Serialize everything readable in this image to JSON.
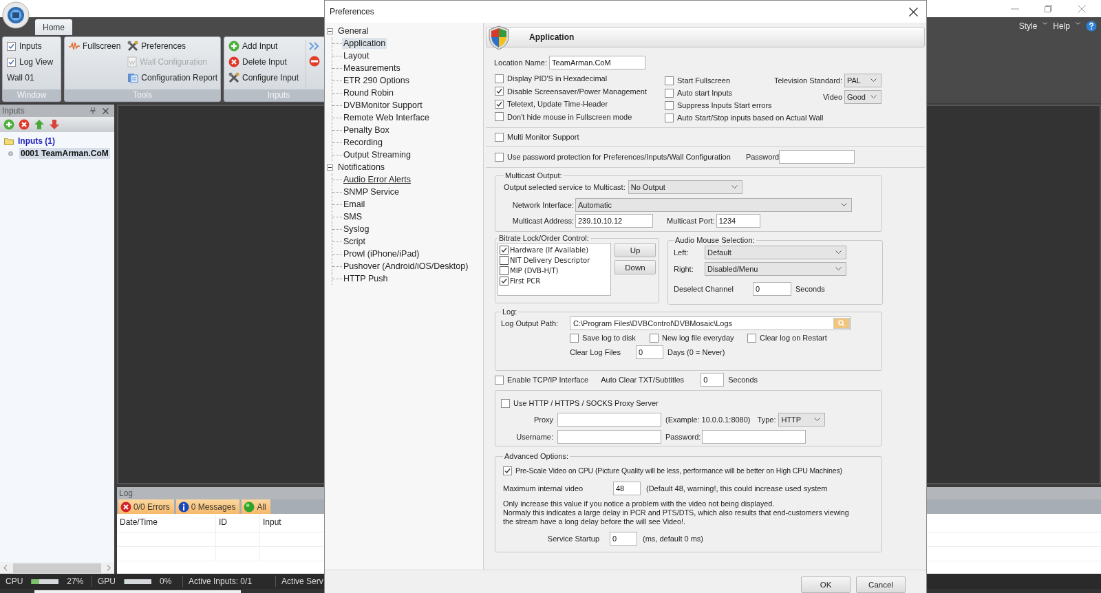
{
  "app": {
    "ribbon": {
      "tabs": [
        {
          "label": "Home",
          "selected": true
        }
      ],
      "menus": [
        {
          "label": "Style"
        },
        {
          "label": "Help"
        }
      ],
      "groups": [
        {
          "title": "Window",
          "columns": [
            [
              {
                "kind": "check",
                "label": "Inputs",
                "checked": true
              },
              {
                "kind": "check",
                "label": "Log View",
                "checked": true
              },
              {
                "kind": "text",
                "label": "Wall 01"
              }
            ]
          ]
        },
        {
          "title": "Tools",
          "columns": [
            [
              {
                "kind": "button",
                "label": "Fullscreen",
                "disabled": false
              }
            ],
            [
              {
                "kind": "button",
                "label": "Preferences",
                "disabled": false
              },
              {
                "kind": "button",
                "label": "Wall Configuration",
                "disabled": true
              },
              {
                "kind": "button",
                "label": "Configuration Report",
                "disabled": false
              }
            ]
          ]
        },
        {
          "title": "Inputs",
          "columns": [
            [
              {
                "kind": "button",
                "label": "Add Input",
                "disabled": false
              },
              {
                "kind": "button",
                "label": "Delete Input",
                "disabled": false
              },
              {
                "kind": "button",
                "label": "Configure Input",
                "disabled": false
              }
            ]
          ]
        }
      ]
    },
    "inputs_panel": {
      "title": "Inputs",
      "tree": [
        {
          "label": "Inputs (1)",
          "children": [
            {
              "label": "0001 TeamArman.CoM",
              "selected": true
            }
          ]
        }
      ]
    },
    "log_panel": {
      "title": "Log",
      "filters": [
        {
          "label": "0/0 Errors"
        },
        {
          "label": "0 Messages"
        },
        {
          "label": "All"
        }
      ],
      "columns": [
        "Date/Time",
        "ID",
        "Input"
      ]
    },
    "status_bar": {
      "cpu": {
        "label": "CPU",
        "level": 0.27,
        "reading": "27%"
      },
      "gpu": {
        "label": "GPU",
        "level": 0,
        "reading": "0%"
      },
      "texts": [
        "Active Inputs: 0/1",
        "Active Serv"
      ]
    }
  },
  "dialog": {
    "title": "Preferences",
    "tree": [
      {
        "label": "General",
        "expanded": true,
        "children": [
          {
            "label": "Application",
            "selected": true,
            "hovered": false
          },
          {
            "label": "Layout",
            "selected": false,
            "hovered": false
          },
          {
            "label": "Measurements",
            "selected": false,
            "hovered": false
          },
          {
            "label": "ETR 290 Options",
            "selected": false,
            "hovered": false
          },
          {
            "label": "Round Robin",
            "selected": false,
            "hovered": false
          },
          {
            "label": "DVBMonitor Support",
            "selected": false,
            "hovered": false
          },
          {
            "label": "Remote Web Interface",
            "selected": false,
            "hovered": false
          },
          {
            "label": "Penalty Box",
            "selected": false,
            "hovered": false
          },
          {
            "label": "Recording",
            "selected": false,
            "hovered": false
          },
          {
            "label": "Output Streaming",
            "selected": false,
            "hovered": false
          }
        ]
      },
      {
        "label": "Notifications",
        "expanded": true,
        "children": [
          {
            "label": "Audio Error Alerts",
            "selected": false,
            "hovered": true
          },
          {
            "label": "SNMP Service",
            "selected": false,
            "hovered": false
          },
          {
            "label": "Email",
            "selected": false,
            "hovered": false
          },
          {
            "label": "SMS",
            "selected": false,
            "hovered": false
          },
          {
            "label": "Syslog",
            "selected": false,
            "hovered": false
          },
          {
            "label": "Script",
            "selected": false,
            "hovered": false
          },
          {
            "label": "Prowl (iPhone/iPad)",
            "selected": false,
            "hovered": false
          },
          {
            "label": "Pushover (Android/iOS/Desktop)",
            "selected": false,
            "hovered": false
          },
          {
            "label": "HTTP Push",
            "selected": false,
            "hovered": false
          }
        ]
      }
    ],
    "settings": {
      "header": "Application",
      "location": {
        "label": "Location Name:",
        "value": "TeamArman.CoM"
      },
      "options_left": [
        {
          "label": "Display PID'S in Hexadecimal",
          "checked": false
        },
        {
          "label": "Disable Screensaver/Power Management",
          "checked": true
        },
        {
          "label": "Teletext, Update Time-Header",
          "checked": true
        },
        {
          "label": "Don't hide mouse in Fullscreen mode",
          "checked": false
        }
      ],
      "options_right": [
        {
          "label": "Start Fullscreen",
          "checked": false
        },
        {
          "label": "Auto start Inputs",
          "checked": false
        },
        {
          "label": "Suppress Inputs Start errors",
          "checked": false
        },
        {
          "label": "Auto Start/Stop inputs based on Actual Wall",
          "checked": false
        }
      ],
      "tv_standard": {
        "label": "Television Standard:",
        "value": "PAL"
      },
      "video": {
        "label": "Video",
        "value": "Good"
      },
      "multi_monitor": {
        "label": "Multi Monitor Support",
        "checked": false
      },
      "password_protection": {
        "label": "Use password protection for Preferences/Inputs/Wall Configuration",
        "checked": false
      },
      "password": {
        "label": "Password"
      },
      "multicast": {
        "title": "Multicast Output:",
        "output_label": "Output selected service to Multicast:",
        "output_value": "No Output",
        "interface_label": "Network Interface:",
        "interface_value": "Automatic",
        "address_label": "Multicast Address:",
        "address_value": "239.10.10.12",
        "port_label": "Multicast Port:",
        "port_value": "1234"
      },
      "bitrate": {
        "title": "Bitrate Lock/Order Control:",
        "items": [
          {
            "label": "Hardware (If Available)",
            "checked": true
          },
          {
            "label": "NIT Delivery Descriptor",
            "checked": false
          },
          {
            "label": "MIP (DVB-H/T)",
            "checked": false
          },
          {
            "label": "First PCR",
            "checked": true
          }
        ],
        "buttons": [
          "Up",
          "Down"
        ]
      },
      "audio_mouse": {
        "title": "Audio Mouse Selection:",
        "left_label": "Left:",
        "left_value": "Default",
        "right_label": "Right:",
        "right_value": "Disabled/Menu",
        "deselect_label": "Deselect Channel",
        "deselect_value": "0",
        "deselect_unit": "Seconds"
      },
      "log": {
        "title": "Log:",
        "path_label": "Log Output Path:",
        "path_value": "C:\\Program Files\\DVBControl\\DVBMosaic\\Logs",
        "options": [
          {
            "label": "Save log to disk",
            "checked": false
          },
          {
            "label": "New log file everyday",
            "checked": false
          },
          {
            "label": "Clear log on Restart",
            "checked": false
          }
        ],
        "clear_label": "Clear Log Files",
        "clear_value": "0",
        "clear_unit": "Days (0 = Never)"
      },
      "tcp": {
        "label": "Enable TCP/IP Interface",
        "checked": false
      },
      "auto_clear": {
        "label": "Auto Clear TXT/Subtitles",
        "value": "0",
        "unit": "Seconds"
      },
      "proxy": {
        "enable": {
          "label": "Use HTTP / HTTPS / SOCKS Proxy Server",
          "checked": false
        },
        "proxy_label": "Proxy",
        "example": "(Example: 10.0.0.1:8080)",
        "type_label": "Type:",
        "type_value": "HTTP",
        "username_label": "Username:",
        "password_label": "Password:"
      },
      "advanced": {
        "title": "Advanced Options:",
        "prescale": {
          "label": "Pre-Scale Video on CPU (Picture Quality will be less, performance will be better on High CPU Machines)",
          "checked": true
        },
        "max_label": "Maximum internal video",
        "max_value": "48",
        "max_note": "(Default 48, warning!, this could increase used system",
        "note_lines": [
          "Only increase this value if you notice a problem with the video not being displayed.",
          "Normaly this indicates a large delay in PCR and PTS/DTS, which also results that end-customers viewing",
          "the stream have a long delay before the will see Video!."
        ],
        "startup_label": "Service Startup",
        "startup_value": "0",
        "startup_note": "(ms, default 0 ms)"
      }
    },
    "buttons": [
      "OK",
      "Cancel"
    ]
  }
}
